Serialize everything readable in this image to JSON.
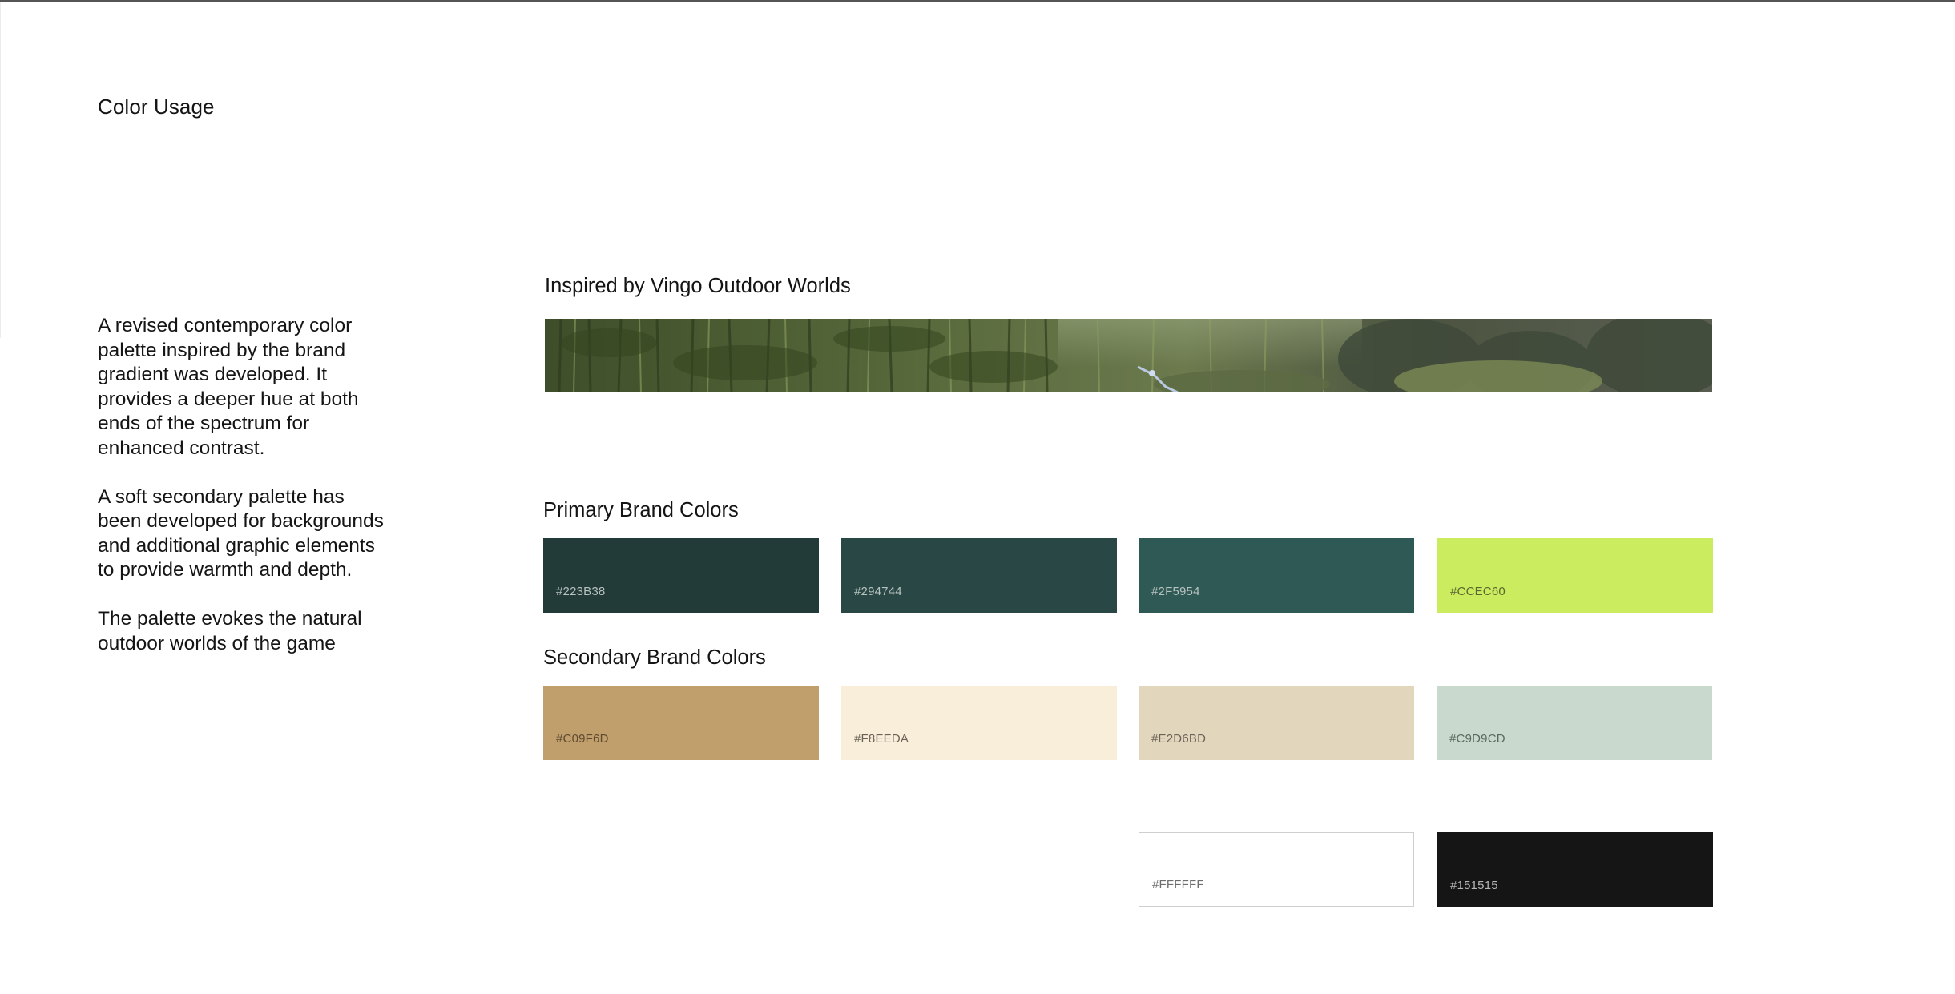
{
  "page": {
    "title": "Color Usage"
  },
  "intro": {
    "paragraphs": [
      "A revised contemporary color palette inspired by the brand gradient was developed. It provides a deeper hue at both ends of the spectrum for enhanced contrast.",
      "A soft secondary palette has been developed for backgrounds and additional graphic elements to provide warmth and depth.",
      "The palette evokes the natural outdoor worlds of the game"
    ]
  },
  "inspiration": {
    "heading": "Inspired by Vingo Outdoor Worlds",
    "image_icon": "forest-banner-image"
  },
  "primary": {
    "heading": "Primary Brand Colors",
    "swatches": [
      {
        "code": "#223B38",
        "color": "#223B38",
        "text_color": "#b8c2bf"
      },
      {
        "code": "#294744",
        "color": "#294744",
        "text_color": "#b8c2bf"
      },
      {
        "code": "#2F5954",
        "color": "#2F5954",
        "text_color": "#b8c2bf"
      },
      {
        "code": "#CCEC60",
        "color": "#CCEC60",
        "text_color": "#5a6630"
      }
    ]
  },
  "secondary": {
    "heading": "Secondary Brand Colors",
    "swatches": [
      {
        "code": "#C09F6D",
        "color": "#C09F6D",
        "text_color": "#5e4a2e"
      },
      {
        "code": "#F8EEDA",
        "color": "#F8EEDA",
        "text_color": "#6b6356"
      },
      {
        "code": "#E2D6BD",
        "color": "#E2D6BD",
        "text_color": "#6b6356"
      },
      {
        "code": "#C9D9CD",
        "color": "#C9D9CD",
        "text_color": "#5b6860"
      }
    ]
  },
  "neutral": {
    "swatches": [
      {
        "code": "#FFFFFF",
        "color": "#FFFFFF",
        "text_color": "#6e6e6e"
      },
      {
        "code": "#151515",
        "color": "#151515",
        "text_color": "#b5b5b5"
      }
    ]
  }
}
